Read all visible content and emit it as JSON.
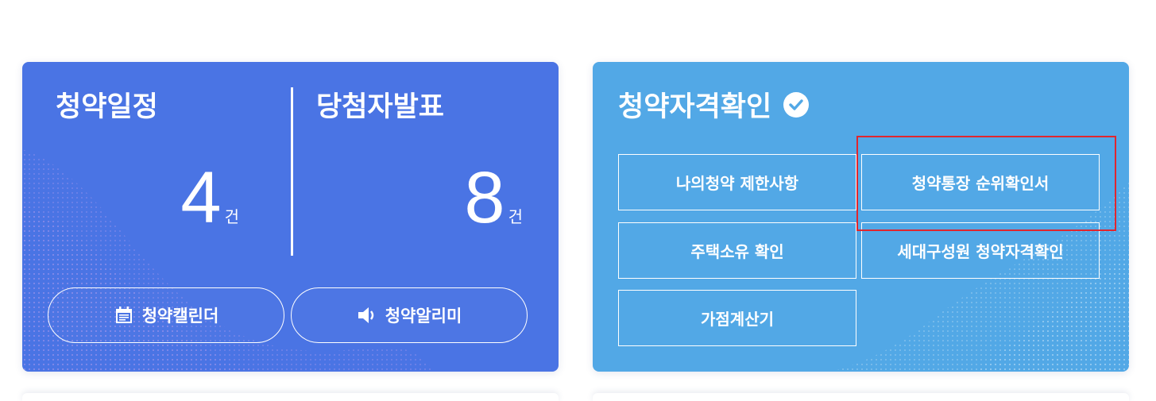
{
  "schedule": {
    "title": "청약일정",
    "count": "4",
    "unit": "건"
  },
  "winners": {
    "title": "당첨자발표",
    "count": "8",
    "unit": "건"
  },
  "buttons": {
    "calendar_label": "청약캘린더",
    "calendar_icon": "calendar-icon",
    "alarm_label": "청약알리미",
    "alarm_icon": "speaker-icon"
  },
  "qualification": {
    "title": "청약자격확인",
    "title_icon": "check-circle-icon",
    "items": [
      {
        "label": "나의청약 제한사항"
      },
      {
        "label": "청약통장 순위확인서"
      },
      {
        "label": "주택소유 확인"
      },
      {
        "label": "세대구성원 청약자격확인"
      },
      {
        "label": "가점계산기"
      }
    ]
  },
  "colors": {
    "left_card_bg": "#4a74e4",
    "right_card_bg": "#52a8e6",
    "highlight": "#e0262e",
    "text": "#ffffff"
  }
}
